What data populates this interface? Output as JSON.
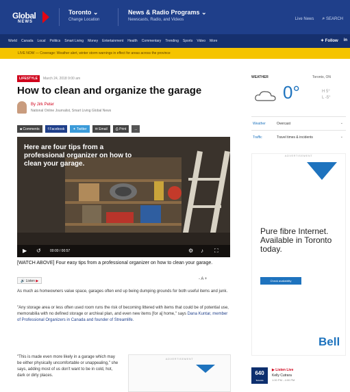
{
  "header": {
    "logo_word": "Global",
    "logo_sub": "NEWS",
    "city": "Toronto",
    "city_sub": "Change Location",
    "programs": "News & Radio Programs",
    "programs_sub": "Newscasts, Radio, and Videos",
    "right_link": "Live News",
    "search": "SEARCH"
  },
  "nav": {
    "items": [
      "World",
      "Canada",
      "Local",
      "Politics",
      "Smart Living",
      "Money",
      "Entertainment",
      "Health",
      "Commentary",
      "Trending",
      "Sports",
      "Video",
      "More"
    ],
    "follow": "Follow",
    "social": "in"
  },
  "alert": {
    "text": "LIVE NOW — Coverage: Weather alert, winter storm warnings in effect for areas across the province"
  },
  "article": {
    "category": "LIFESTYLE",
    "timestamp": "March 24, 2018 9:00 am",
    "title": "How to clean and organize the garage",
    "author_name": "By Jirk Peter",
    "author_title": "National Online Journalist, Smart Living  Global News",
    "share": {
      "comments": "Comments",
      "facebook": "Facebook",
      "twitter": "Twitter",
      "email": "Email",
      "print": "Print",
      "more": "..."
    },
    "video_caption": "Here are four tips from a professional organizer on how to clean your garage.",
    "video_time": "00:00 / 00:57",
    "caption": "[WATCH ABOVE] Four easy tips from a professional organizer on how to clean your garage.",
    "listen": "Listen",
    "font_ctrl": "- A +",
    "p1": "As much as homeowners value space, garages often end up being dumping grounds for both useful items and junk.",
    "p2_a": "\"Any storage area or less often used room runs the risk of becoming littered with items that could be of potential use, memorabilia with no defined storage or archival plan, and even new items [for a] home,\" says ",
    "p2_link": "Dana Kuntar, member of Professional Organizers in Canada and founder of Streamlife.",
    "p3": "\"This is made even more likely in a garage which may be either physically uncomfortable or unappealing,\" she says, adding most of us don't want to be in cold, hot, dark or dirty places.",
    "ad_label": "ADVERTISEMENT"
  },
  "sidebar": {
    "weather_title": "WEATHER",
    "weather_loc": "Toronto, ON",
    "temp": "0°",
    "hi": "H 5°",
    "lo": "L -5°",
    "rows": [
      {
        "k": "Weather",
        "v": "Overcast"
      },
      {
        "k": "Traffic",
        "v": "Travel times & incidents"
      }
    ],
    "ad_label": "ADVERTISEMENT",
    "ad_headline": "Pure fibre Internet. Available in Toronto today.",
    "ad_button": "Check availability",
    "ad_brand": "Bell",
    "radio_logo": "640",
    "radio_logo_sub": "Toronto",
    "radio_live": "Listen Live",
    "radio_show": "Kelly Cutrara",
    "radio_time": "1:00 PM - 4:00 PM",
    "colors": {
      "brand_blue": "#1f3f8a",
      "accent_red": "#d0021b",
      "alert_yellow": "#f5c400",
      "link_blue": "#1e73be"
    }
  }
}
